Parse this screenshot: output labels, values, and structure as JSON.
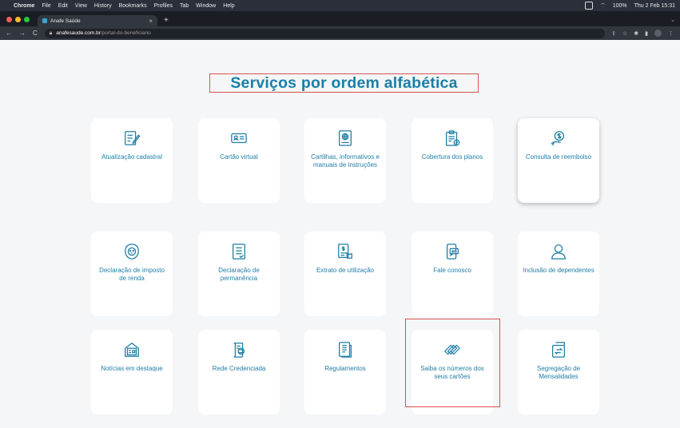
{
  "menubar": {
    "app": "Chrome",
    "items": [
      "File",
      "Edit",
      "View",
      "History",
      "Bookmarks",
      "Profiles",
      "Tab",
      "Window",
      "Help"
    ],
    "battery": "100%",
    "clock": "Thu 2 Feb 15:31"
  },
  "browser": {
    "tab_title": "Anafe Saúde",
    "url_host": "anafesaude.com.br",
    "url_path": "/portal-do-beneficiario"
  },
  "page": {
    "title": "Serviços por ordem alfabética",
    "cards": [
      {
        "label": "Atualização cadastral",
        "icon": "edit-form-icon"
      },
      {
        "label": "Cartão virtual",
        "icon": "id-card-icon"
      },
      {
        "label": "Cartilhas, informativos e manuais de instruções",
        "icon": "booklet-icon"
      },
      {
        "label": "Cobertura dos planos",
        "icon": "clipboard-check-icon"
      },
      {
        "label": "Consulta de reembolso",
        "icon": "money-hand-icon"
      },
      {
        "label": "Declaração de imposto de renda",
        "icon": "lion-icon"
      },
      {
        "label": "Declaração de permanência",
        "icon": "document-icon"
      },
      {
        "label": "Extrato de utilização",
        "icon": "statement-icon"
      },
      {
        "label": "Fale conosco",
        "icon": "phone-chat-icon"
      },
      {
        "label": "Inclusão de dependentes",
        "icon": "user-icon"
      },
      {
        "label": "Notícias em destaque",
        "icon": "news-icon"
      },
      {
        "label": "Rede Credenciada",
        "icon": "network-scroll-icon"
      },
      {
        "label": "Regulamentos",
        "icon": "rules-doc-icon"
      },
      {
        "label": "Saiba os números dos seus cartões",
        "icon": "cards-stack-icon"
      },
      {
        "label": "Segregação de Mensalidades",
        "icon": "transfer-icon"
      }
    ]
  },
  "colors": {
    "accent": "#1f7ea6",
    "highlight": "#d9534f"
  }
}
